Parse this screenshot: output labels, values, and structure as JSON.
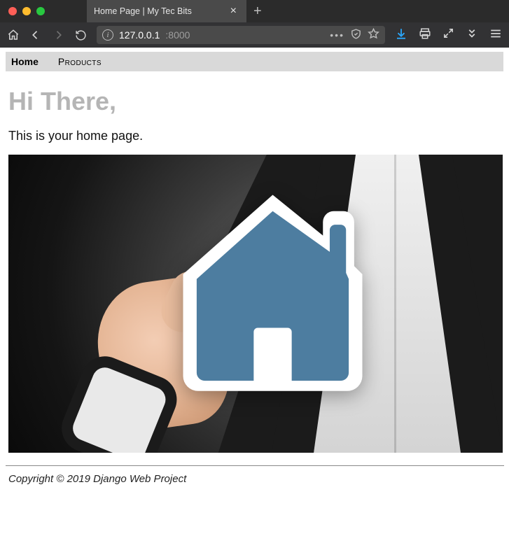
{
  "browser": {
    "tab_title": "Home Page | My Tec Bits",
    "url_host": "127.0.0.1",
    "url_port": ":8000"
  },
  "menu": {
    "home": "Home",
    "products": "Products"
  },
  "page": {
    "heading": "Hi There,",
    "subtext": "This is your home page.",
    "footer": "Copyright © 2019 Django Web Project"
  },
  "colors": {
    "house_fill": "#4d7da0",
    "house_border": "#ffffff"
  }
}
